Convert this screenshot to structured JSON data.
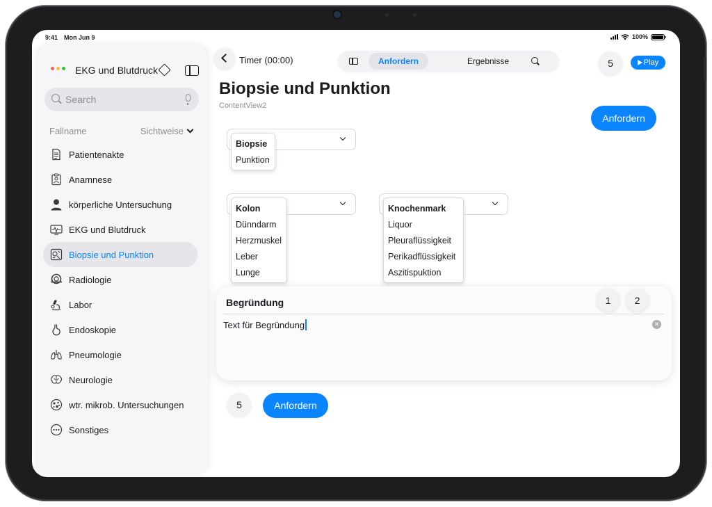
{
  "status_bar": {
    "time": "9:41",
    "date": "Mon Jun 9",
    "battery": "100%",
    "battery_level": 1.0
  },
  "sidebar": {
    "title": "EKG und Blutdruck",
    "traffic_colors": [
      "#ff5f57",
      "#febc2e",
      "#28c840"
    ],
    "search": {
      "placeholder": "Search"
    },
    "section": {
      "left": "Fallname",
      "right": "Sichtweise"
    },
    "items": [
      {
        "label": "Patientenakte",
        "icon": "document-icon"
      },
      {
        "label": "Anamnese",
        "icon": "clipboard-icon"
      },
      {
        "label": "körperliche Untersuchung",
        "icon": "doctor-icon"
      },
      {
        "label": "EKG und Blutdruck",
        "icon": "ecg-monitor-icon"
      },
      {
        "label": "Biopsie und Punktion",
        "icon": "biopsy-icon",
        "active": true
      },
      {
        "label": "Radiologie",
        "icon": "mri-scanner-icon"
      },
      {
        "label": "Labor",
        "icon": "microscope-icon"
      },
      {
        "label": "Endoskopie",
        "icon": "stomach-icon"
      },
      {
        "label": "Pneumologie",
        "icon": "lungs-icon"
      },
      {
        "label": "Neurologie",
        "icon": "brain-icon"
      },
      {
        "label": "wtr. mikrob. Untersuchungen",
        "icon": "bacteria-icon"
      },
      {
        "label": "Sonstiges",
        "icon": "ellipsis-icon"
      }
    ]
  },
  "toolbar": {
    "timer": "Timer (00:00)",
    "segments": {
      "active": "Anfordern",
      "other": "Ergebnisse"
    },
    "count": "5",
    "play_label": "Play"
  },
  "main": {
    "title": "Biopsie und Punktion",
    "subtitle": "ContentView2",
    "request_button": "Anfordern",
    "picker1": {
      "options": [
        "Biopsie",
        "Punktion"
      ],
      "selected": "Biopsie"
    },
    "picker2": {
      "options": [
        "Kolon",
        "Dünndarm",
        "Herzmuskel",
        "Leber",
        "Lunge"
      ],
      "selected": "Kolon"
    },
    "picker3": {
      "options": [
        "Knochenmark",
        "Liquor",
        "Pleuraflüssigkeit",
        "Perikadflüssigkeit",
        "Aszitispuktion"
      ],
      "selected": "Knochenmark"
    }
  },
  "reason_card": {
    "title": "Begründung",
    "btn1": "1",
    "btn2": "2",
    "text": "Text für Begründung"
  },
  "bottom": {
    "count": "5",
    "request_button": "Anfordern"
  },
  "colors": {
    "accent": "#0a84ff"
  }
}
